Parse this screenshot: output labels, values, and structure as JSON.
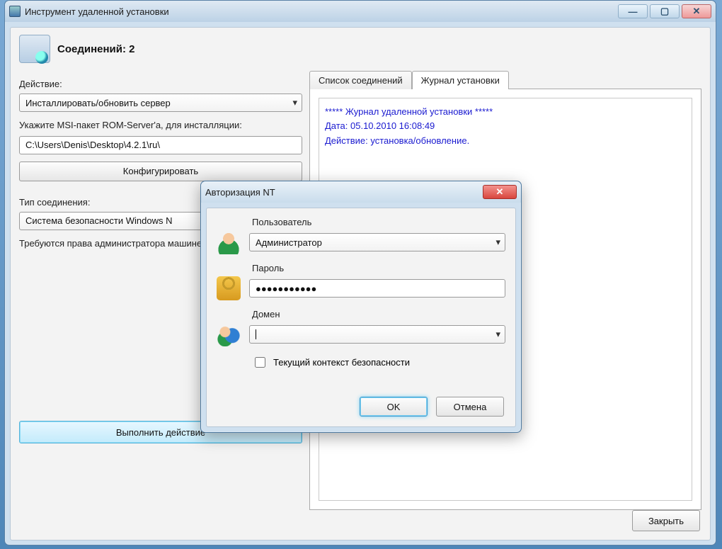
{
  "app": {
    "title": "Инструмент удаленной установки",
    "header": "Соединений: 2"
  },
  "left": {
    "action_label": "Действие:",
    "action_value": "Инсталлировать/обновить сервер",
    "msi_label": "Укажите MSI-пакет ROM-Server'а, для инсталляции:",
    "msi_path": "C:\\Users\\Denis\\Desktop\\4.2.1\\ru\\",
    "configure_btn": "Конфигурировать",
    "conn_type_label": "Тип соединения:",
    "conn_type_value": "Система безопасности Windows N",
    "rights_note": "Требуются права администратора машине.",
    "execute_btn": "Выполнить действие"
  },
  "right": {
    "tab_connections": "Список соединений",
    "tab_log": "Журнал установки",
    "log_line1": "***** Журнал удаленной установки *****",
    "log_line2": "Дата: 05.10.2010 16:08:49",
    "log_line3": "Действие: установка/обновление."
  },
  "footer": {
    "close_btn": "Закрыть"
  },
  "dialog": {
    "title": "Авторизация NT",
    "user_label": "Пользователь",
    "user_value": "Администратор",
    "pass_label": "Пароль",
    "pass_value": "●●●●●●●●●●●",
    "domain_label": "Домен",
    "domain_value": "",
    "context_checkbox": "Текущий контекст безопасности",
    "ok_btn": "OK",
    "cancel_btn": "Отмена"
  }
}
